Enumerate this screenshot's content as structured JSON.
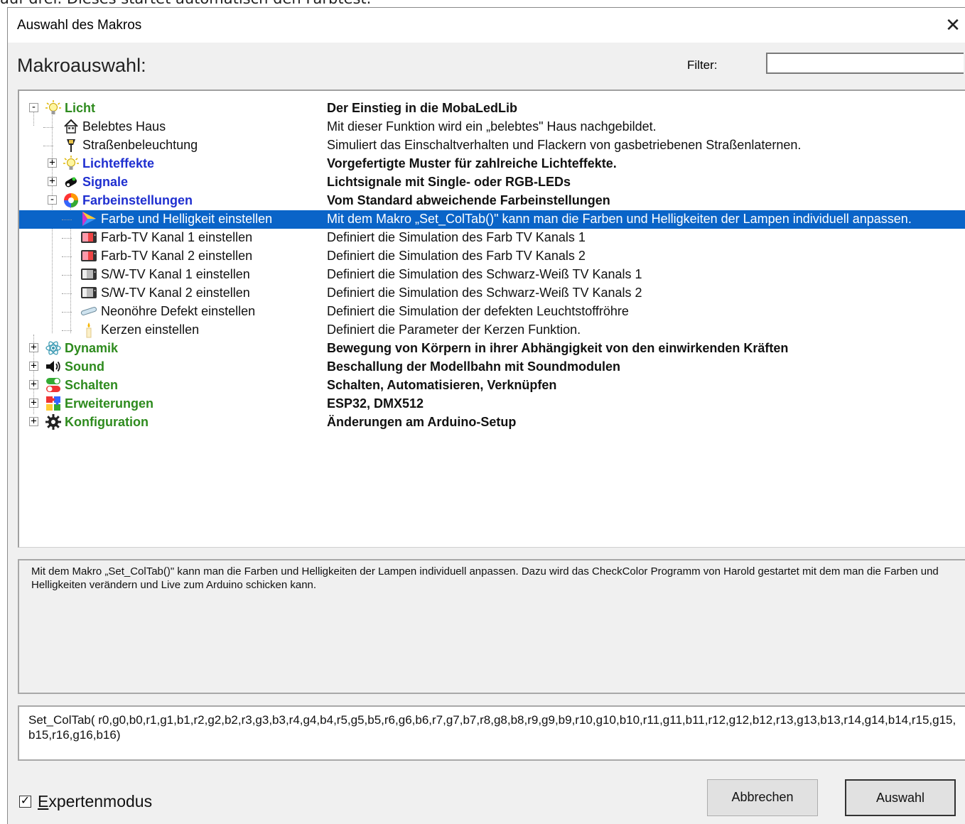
{
  "background_text": "auf drei. Dieses startet automatisch den Farbtest.",
  "window": {
    "title": "Auswahl des Makros",
    "close_glyph": "✕"
  },
  "heading": "Makroauswahl:",
  "filter": {
    "label": "Filter:",
    "value": ""
  },
  "tree": [
    {
      "label": "Licht",
      "desc": "Der Einstieg in die MobaLedLib",
      "icon": "bulb-icon",
      "expander": "-"
    },
    {
      "label": "Belebtes Haus",
      "desc": "Mit dieser Funktion wird ein „belebtes\" Haus nachgebildet.",
      "icon": "house-icon"
    },
    {
      "label": "Straßenbeleuchtung",
      "desc": "Simuliert das Einschaltverhalten und Flackern von gasbetriebenen Straßenlaternen.",
      "icon": "street-lamp-icon"
    },
    {
      "label": "Lichteffekte",
      "desc": "Vorgefertigte Muster für zahlreiche Lichteffekte.",
      "icon": "bulb-icon",
      "expander": "+"
    },
    {
      "label": "Signale",
      "desc": "Lichtsignale mit Single- oder RGB-LEDs",
      "icon": "signal-icon",
      "expander": "+"
    },
    {
      "label": "Farbeinstellungen",
      "desc": "Vom Standard abweichende Farbeinstellungen",
      "icon": "color-wheel-icon",
      "expander": "-"
    },
    {
      "label": "Farbe und Helligkeit einstellen",
      "desc": "Mit dem Makro „Set_ColTab()\" kann man die Farben und Helligkeiten der Lampen individuell anpassen.",
      "icon": "color-triangle-icon"
    },
    {
      "label": "Farb-TV Kanal 1 einstellen",
      "desc": "Definiert die Simulation des Farb TV Kanals 1",
      "icon": "color-tv-icon"
    },
    {
      "label": "Farb-TV Kanal 2 einstellen",
      "desc": "Definiert die Simulation des Farb TV Kanals 2",
      "icon": "color-tv-icon"
    },
    {
      "label": "S/W-TV Kanal 1 einstellen",
      "desc": "Definiert die Simulation des Schwarz-Weiß TV Kanals 1",
      "icon": "bw-tv-icon"
    },
    {
      "label": "S/W-TV Kanal 2 einstellen",
      "desc": "Definiert die Simulation des Schwarz-Weiß TV Kanals 2",
      "icon": "bw-tv-icon"
    },
    {
      "label": "Neonöhre Defekt einstellen",
      "desc": "Definiert die Simulation der defekten Leuchtstoffröhre",
      "icon": "neon-tube-icon"
    },
    {
      "label": "Kerzen einstellen",
      "desc": "Definiert die Parameter der Kerzen Funktion.",
      "icon": "candle-icon"
    },
    {
      "label": "Dynamik",
      "desc": "Bewegung von Körpern in ihrer Abhängigkeit von den einwirkenden Kräften",
      "icon": "atom-icon",
      "expander": "+"
    },
    {
      "label": "Sound",
      "desc": "Beschallung der Modellbahn mit Soundmodulen",
      "icon": "speaker-icon",
      "expander": "+"
    },
    {
      "label": "Schalten",
      "desc": "Schalten, Automatisieren, Verknüpfen",
      "icon": "switch-icon",
      "expander": "+"
    },
    {
      "label": "Erweiterungen",
      "desc": "ESP32, DMX512",
      "icon": "puzzle-icon",
      "expander": "+"
    },
    {
      "label": "Konfiguration",
      "desc": "Änderungen am Arduino-Setup",
      "icon": "gear-icon",
      "expander": "+"
    }
  ],
  "info_text": "Mit dem Makro „Set_ColTab()\" kann man die Farben und Helligkeiten der Lampen individuell anpassen. Dazu wird das CheckColor Programm von Harold gestartet mit dem man die Farben und Helligkeiten verändern und Live zum Arduino schicken kann.",
  "code_text": "Set_ColTab( r0,g0,b0,r1,g1,b1,r2,g2,b2,r3,g3,b3,r4,g4,b4,r5,g5,b5,r6,g6,b6,r7,g7,b7,r8,g8,b8,r9,g9,b9,r10,g10,b10,r11,g11,b11,r12,g12,b12,r13,g13,b13,r14,g14,b14,r15,g15,b15,r16,g16,b16)",
  "expert_mode": {
    "label": "Expertenmodus",
    "checked_glyph": "✓"
  },
  "buttons": {
    "cancel": "Abbrechen",
    "ok": "Auswahl"
  },
  "colors": {
    "selection": "#0a64c8",
    "green_label": "#2e8b1e",
    "blue_label": "#1f2fd0"
  }
}
